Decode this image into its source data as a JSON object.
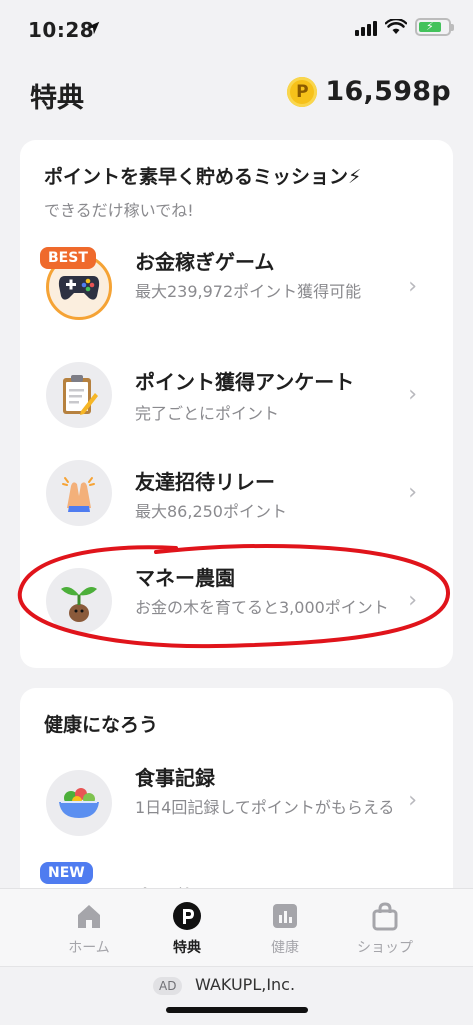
{
  "status": {
    "time": "10:28"
  },
  "header": {
    "title": "特典",
    "points": "16,598p",
    "coin_symbol": "P"
  },
  "missions": {
    "title": "ポイントを素早く貯めるミッション⚡",
    "subtitle": "できるだけ稼いでね!",
    "items": [
      {
        "title": "お金稼ぎゲーム",
        "desc": "最大239,972ポイント獲得可能",
        "badge": "BEST",
        "icon": "gamepad-icon"
      },
      {
        "title": "ポイント獲得アンケート",
        "desc": "完了ごとにポイント",
        "icon": "clipboard-icon"
      },
      {
        "title": "友達招待リレー",
        "desc": "最大86,250ポイント",
        "icon": "high-five-icon"
      },
      {
        "title": "マネー農園",
        "desc": "お金の木を育てると3,000ポイント",
        "icon": "sprout-icon"
      }
    ]
  },
  "health": {
    "title": "健康になろう",
    "items": [
      {
        "title": "食事記録",
        "desc": "1日4回記録してポイントがもらえる",
        "icon": "salad-bowl-icon"
      },
      {
        "title": "水を飲む",
        "badge": "NEW",
        "icon": "water-icon"
      }
    ]
  },
  "tabs": [
    {
      "label": "ホーム",
      "icon": "home-icon"
    },
    {
      "label": "特典",
      "icon": "points-icon",
      "active": true
    },
    {
      "label": "健康",
      "icon": "chart-icon"
    },
    {
      "label": "ショップ",
      "icon": "shopping-bag-icon"
    }
  ],
  "ad": {
    "badge": "AD",
    "text": "WAKUPL,Inc."
  },
  "colors": {
    "accent_orange": "#ef6a2c",
    "new_blue": "#4f7cf0",
    "circle_red": "#e0141b",
    "coin": "#f6c11a"
  }
}
